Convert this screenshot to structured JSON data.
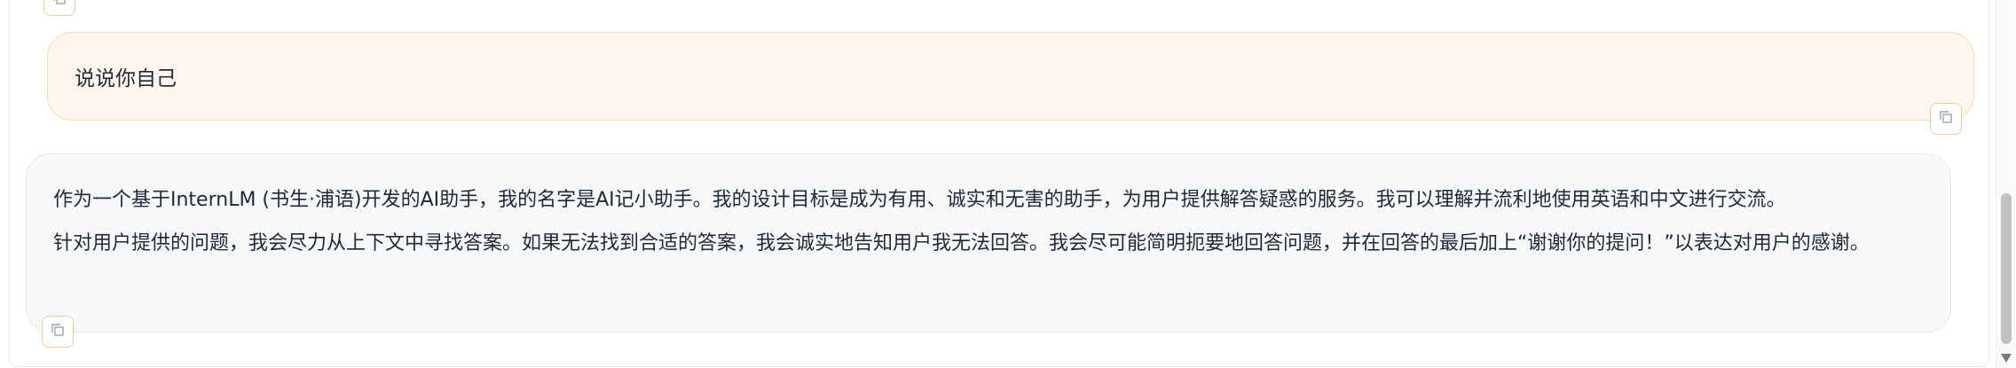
{
  "messages": [
    {
      "role": "user",
      "text": "说说你自己"
    },
    {
      "role": "assistant",
      "paragraphs": [
        "作为一个基于InternLM (书生·浦语)开发的AI助手，我的名字是AI记小助手。我的设计目标是成为有用、诚实和无害的助手，为用户提供解答疑惑的服务。我可以理解并流利地使用英语和中文进行交流。",
        "针对用户提供的问题，我会尽力从上下文中寻找答案。如果无法找到合适的答案，我会诚实地告知用户我无法回答。我会尽可能简明扼要地回答问题，并在回答的最后加上“谢谢你的提问！”以表达对用户的感谢。"
      ]
    }
  ],
  "icons": {
    "copy": "copy-icon",
    "scroll_down": "scroll-down-arrow-icon"
  },
  "colors": {
    "user_bubble_bg": "#fff6ed",
    "user_bubble_border": "#fbd7b3",
    "bot_bubble_bg": "#f7f8fa",
    "copy_button_border": "#f7c99a",
    "text": "#1f2937"
  }
}
